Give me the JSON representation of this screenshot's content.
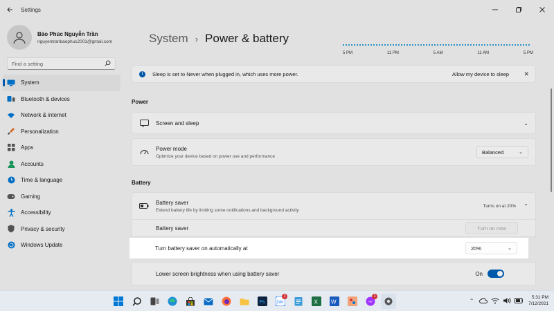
{
  "window": {
    "title": "Settings"
  },
  "profile": {
    "name": "Bảo Phúc Nguyễn Trần",
    "email": "nguyentranbaophuc2001@gmail.com"
  },
  "search": {
    "placeholder": "Find a setting"
  },
  "sidebar": {
    "items": [
      {
        "label": "System",
        "icon": "monitor-icon",
        "color": "#0078d4",
        "active": true
      },
      {
        "label": "Bluetooth & devices",
        "icon": "bluetooth-icon",
        "color": "#0078d4"
      },
      {
        "label": "Network & internet",
        "icon": "wifi-icon",
        "color": "#0078d4"
      },
      {
        "label": "Personalization",
        "icon": "brush-icon",
        "color": "#e8702a"
      },
      {
        "label": "Apps",
        "icon": "apps-icon",
        "color": "#5a5a5a"
      },
      {
        "label": "Accounts",
        "icon": "person-icon",
        "color": "#1aa260"
      },
      {
        "label": "Time & language",
        "icon": "globe-clock-icon",
        "color": "#0078d4"
      },
      {
        "label": "Gaming",
        "icon": "gamepad-icon",
        "color": "#5a5a5a"
      },
      {
        "label": "Accessibility",
        "icon": "accessibility-icon",
        "color": "#0078d4"
      },
      {
        "label": "Privacy & security",
        "icon": "shield-icon",
        "color": "#5a5a5a"
      },
      {
        "label": "Windows Update",
        "icon": "refresh-icon",
        "color": "#0078d4"
      }
    ]
  },
  "breadcrumb": {
    "parent": "System",
    "separator": "›",
    "current": "Power & battery"
  },
  "graph": {
    "ticks": [
      "5 PM",
      "11 PM",
      "5 AM",
      "11 AM",
      "5 PM"
    ]
  },
  "info_bar": {
    "text": "Sleep is set to Never when plugged in, which uses more power.",
    "link": "Allow my device to sleep"
  },
  "power": {
    "heading": "Power",
    "screen_sleep": {
      "title": "Screen and sleep"
    },
    "power_mode": {
      "title": "Power mode",
      "subtitle": "Optimize your device based on power use and performance",
      "value": "Balanced"
    }
  },
  "battery": {
    "heading": "Battery",
    "saver": {
      "title": "Battery saver",
      "subtitle": "Extend battery life by limiting some notifications and background activity",
      "status": "Turns on at 20%"
    },
    "saver_now": {
      "title": "Battery saver",
      "button": "Turn on now"
    },
    "auto_on": {
      "title": "Turn battery saver on automatically at",
      "value": "20%"
    },
    "brightness": {
      "title": "Lower screen brightness when using battery saver",
      "toggle_label": "On",
      "toggle_on": true
    }
  },
  "taskbar": {
    "time": "5:31 PM",
    "date": "7/12/2021",
    "apps": [
      {
        "icon": "windows-start-icon"
      },
      {
        "icon": "search-icon"
      },
      {
        "icon": "task-view-icon"
      },
      {
        "icon": "edge-icon"
      },
      {
        "icon": "store-icon"
      },
      {
        "icon": "mail-icon"
      },
      {
        "icon": "firefox-icon"
      },
      {
        "icon": "file-explorer-icon"
      },
      {
        "icon": "photoshop-icon"
      },
      {
        "icon": "zalo-icon",
        "badge": "2"
      },
      {
        "icon": "notepad-icon"
      },
      {
        "icon": "excel-icon"
      },
      {
        "icon": "word-icon"
      },
      {
        "icon": "paint-icon"
      },
      {
        "icon": "messenger-icon",
        "badge": "1"
      },
      {
        "icon": "settings-icon"
      }
    ]
  }
}
